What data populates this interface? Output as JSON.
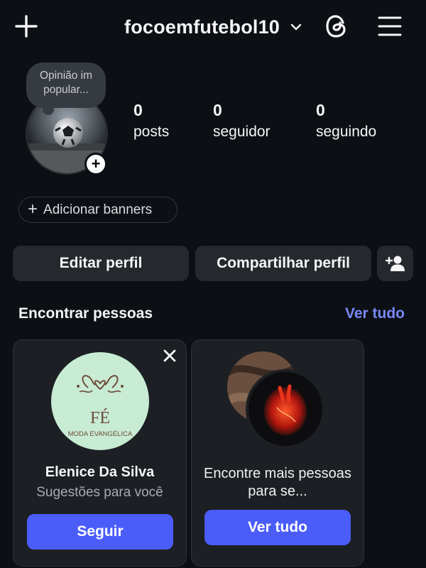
{
  "header": {
    "username": "focoemfutebol10",
    "icons": [
      "plus-icon",
      "chevron-down-icon",
      "threads-icon",
      "menu-icon"
    ]
  },
  "profile": {
    "note": "Opinião im\npopular...",
    "stats": [
      {
        "value": "0",
        "label": "posts"
      },
      {
        "value": "0",
        "label": "seguidor"
      },
      {
        "value": "0",
        "label": "seguindo"
      }
    ]
  },
  "banners": {
    "label": "Adicionar banners"
  },
  "actions": {
    "edit_label": "Editar perfil",
    "share_label": "Compartilhar perfil"
  },
  "discover": {
    "title": "Encontrar pessoas",
    "see_all": "Ver tudo",
    "suggestion": {
      "name": "Elenice Da Silva",
      "subtitle": "Sugestões para você",
      "button": "Seguir",
      "logo_text_main": "FÉ",
      "logo_text_sub": "MODA EVANGÉLICA"
    },
    "more_card": {
      "text": "Encontre mais pessoas para se...",
      "button": "Ver tudo"
    }
  },
  "colors": {
    "background": "#0c1014",
    "button_gray": "#25292e",
    "accent_blue": "#4a5df9",
    "link_blue": "#7a88f9"
  }
}
